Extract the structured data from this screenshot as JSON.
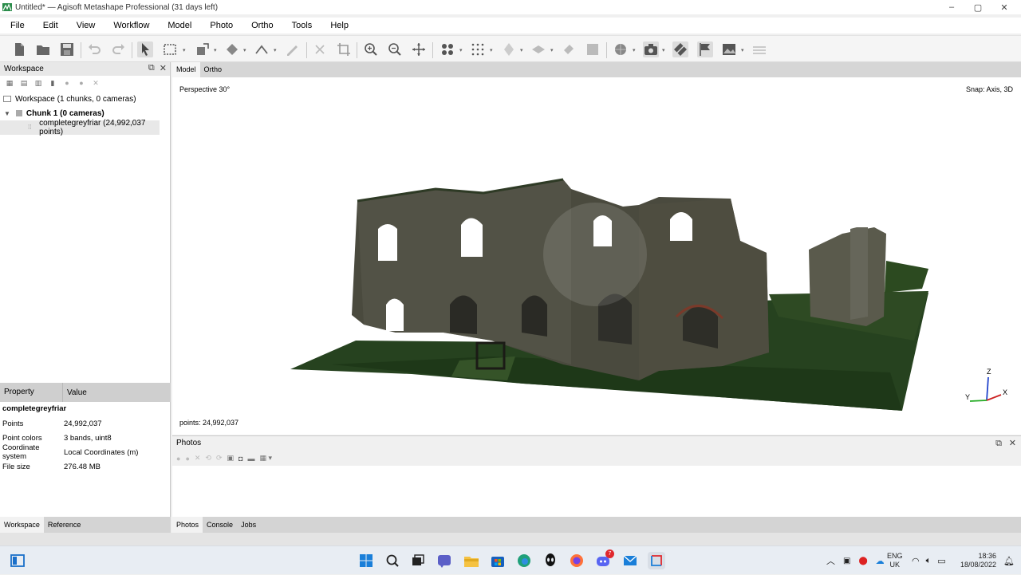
{
  "window": {
    "title": "Untitled* — Agisoft Metashape Professional (31 days left)",
    "minimize": "–",
    "maximize": "▢",
    "close": "✕"
  },
  "menu": [
    "File",
    "Edit",
    "View",
    "Workflow",
    "Model",
    "Photo",
    "Ortho",
    "Tools",
    "Help"
  ],
  "workspace": {
    "panel_title": "Workspace",
    "root": "Workspace (1 chunks, 0 cameras)",
    "chunk": "Chunk 1 (0 cameras)",
    "point_cloud": "completegreyfriar (24,992,037 points)"
  },
  "properties": {
    "col_property": "Property",
    "col_value": "Value",
    "object_name": "completegreyfriar",
    "rows": [
      {
        "name": "Points",
        "value": "24,992,037"
      },
      {
        "name": "Point colors",
        "value": "3 bands, uint8"
      },
      {
        "name": "Coordinate system",
        "value": "Local Coordinates (m)"
      },
      {
        "name": "File size",
        "value": "276.48 MB"
      }
    ]
  },
  "left_tabs": [
    "Workspace",
    "Reference"
  ],
  "view_tabs": [
    "Model",
    "Ortho"
  ],
  "viewport": {
    "projection": "Perspective 30°",
    "snap": "Snap: Axis, 3D",
    "points": "points: 24,992,037",
    "axis_x": "X",
    "axis_y": "Y",
    "axis_z": "Z"
  },
  "photos": {
    "title": "Photos"
  },
  "bottom_tabs": [
    "Photos",
    "Console",
    "Jobs"
  ],
  "taskbar": {
    "lang_top": "ENG",
    "lang_bottom": "UK",
    "time": "18:36",
    "date": "18/08/2022",
    "discord_badge": "7"
  }
}
